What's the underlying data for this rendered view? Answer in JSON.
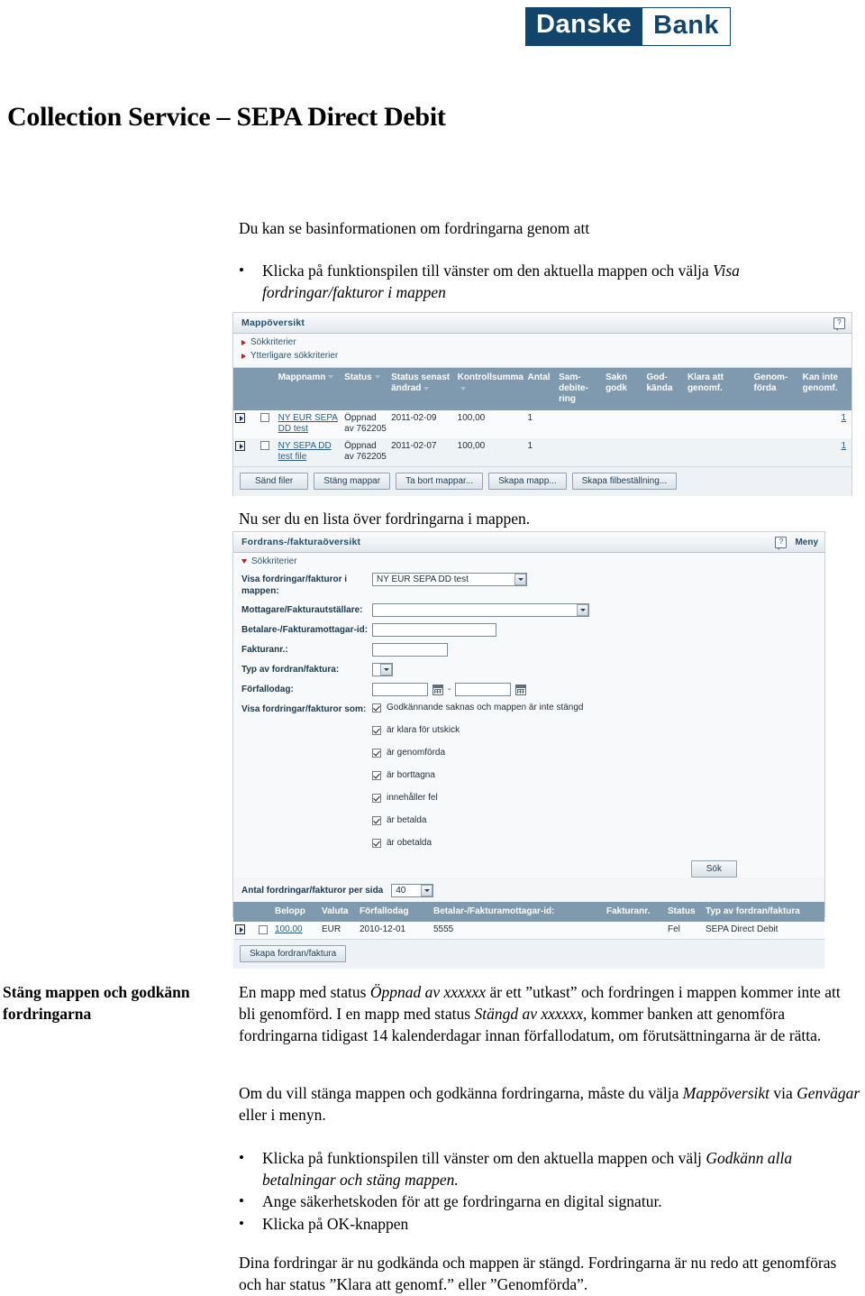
{
  "logo": {
    "part1": "Danske",
    "part2": "Bank"
  },
  "document": {
    "title": "Collection Service – SEPA Direct Debit",
    "intro": "Du kan se basinformationen om fordringarna genom att",
    "bullet1_plain": "Klicka på funktionspilen till vänster om den aktuella mappen och välja ",
    "bullet1_italic": "Visa fordringar/fakturor i mappen",
    "caption_list": "Nu ser du en lista över fordringarna i mappen.",
    "side_heading": "Stäng mappen och godkänn fordringarna",
    "para1_a": "En mapp med status ",
    "para1_i1": "Öppnad av xxxxxx",
    "para1_b": " är ett ”utkast” och fordringen i mappen kommer inte att bli genomförd. I en mapp med status ",
    "para1_i2": "Stängd av xxxxxx,",
    "para1_c": " kommer banken att genomföra fordringarna tidigast 14 kalenderdagar innan förfallodatum, om förutsättningarna är de rätta.",
    "para2_a": "Om du vill stänga mappen och godkänna fordringarna, måste du välja ",
    "para2_i1": "Mappöversikt",
    "para2_b": " via ",
    "para2_i2": "Genvägar",
    "para2_c": " eller i menyn.",
    "bullet2_plain": "Klicka på funktionspilen till vänster om den aktuella mappen och välj ",
    "bullet2_italic": "Godkänn alla betalningar och stäng mappen.",
    "bullet3": "Ange säkerhetskoden för att ge fordringarna en digital signatur.",
    "bullet4": "Klicka på OK-knappen",
    "para3": "Dina fordringar är nu godkända och mappen är stängd. Fordringarna är nu redo att genomföras och har status ”Klara att genomf.” eller ”Genomförda”.",
    "bullet_glyph": "•"
  },
  "app1": {
    "title": "Mappöversikt",
    "criteria_1": "Sökkriterier",
    "criteria_2": "Ytterligare sökkriterier",
    "columns": [
      "Mappnamn",
      "Status",
      "Status senast ändrad",
      "Kontrollsumma",
      "Antal",
      "Sam-debite-ring",
      "Sakn godk",
      "God-kända",
      "Klara att genomf.",
      "Genom-förda",
      "Kan inte genomf."
    ],
    "rows": [
      {
        "name": "NY EUR SEPA DD test",
        "status": "Öppnad av 762205",
        "changed": "2011-02-09",
        "checksum": "100,00",
        "count": "1",
        "samdeb": "",
        "saknGodk": "",
        "godkanda": "",
        "klara": "",
        "genomforda": "",
        "kanInte": "1"
      },
      {
        "name": "NY SEPA DD test file",
        "status": "Öppnad av 762205",
        "changed": "2011-02-07",
        "checksum": "100,00",
        "count": "1",
        "samdeb": "",
        "saknGodk": "",
        "godkanda": "",
        "klara": "",
        "genomforda": "",
        "kanInte": "1"
      }
    ],
    "buttons": [
      "Sänd filer",
      "Stäng mappar",
      "Ta bort mappar...",
      "Skapa mapp...",
      "Skapa filbeställning..."
    ]
  },
  "app2": {
    "title": "Fordrans-/fakturaöversikt",
    "menu_label": "Meny",
    "criteria_1": "Sökkriterier",
    "fields": {
      "folder_label": "Visa fordringar/fakturor i mappen:",
      "folder_value": "NY EUR SEPA DD test",
      "receiver_label": "Mottagare/Fakturautställare:",
      "receiver_value": "",
      "payer_label": "Betalare-/Fakturamottagar-id:",
      "payer_value": "",
      "invoice_label": "Fakturanr.:",
      "invoice_value": "",
      "type_label": "Typ av fordran/faktura:",
      "type_value": "",
      "duedate_label": "Förfallodag:",
      "duedate_from": "",
      "duedate_to": "",
      "duedate_dash": "-",
      "showas_label": "Visa fordringar/fakturor som:"
    },
    "checkboxes": [
      {
        "label": "Godkännande saknas och mappen är inte stängd",
        "checked": true
      },
      {
        "label": "är klara för utskick",
        "checked": true
      },
      {
        "label": "är genomförda",
        "checked": true
      },
      {
        "label": "är borttagna",
        "checked": true
      },
      {
        "label": "innehåller fel",
        "checked": true
      },
      {
        "label": "är betalda",
        "checked": true
      },
      {
        "label": "är obetalda",
        "checked": true
      }
    ],
    "search_button": "Sök",
    "perpage_label": "Antal fordringar/fakturor per sida",
    "perpage_value": "40",
    "columns": [
      "Belopp",
      "Valuta",
      "Förfallodag",
      "Betalar-/Fakturamottagar-id:",
      "Fakturanr.",
      "Status",
      "Typ av fordran/faktura"
    ],
    "rows": [
      {
        "amount": "100,00",
        "currency": "EUR",
        "duedate": "2010-12-01",
        "payerid": "5555",
        "invoiceno": "",
        "status": "Fel",
        "type": "SEPA Direct Debit"
      }
    ],
    "create_button": "Skapa fordran/faktura"
  },
  "colors": {
    "brand_navy": "#12456b",
    "table_header": "#7f9aae",
    "link": "#2a6088",
    "arrow_red": "#b32424"
  }
}
